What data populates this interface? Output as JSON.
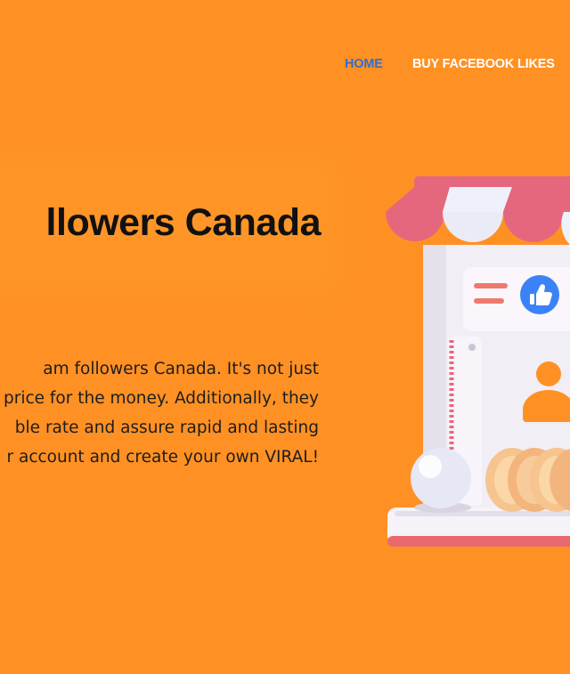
{
  "nav": {
    "home_label": "HOME",
    "buy_facebook_likes_label": "BUY FACEBOOK LIKES"
  },
  "hero": {
    "title": "llowers Canada",
    "paragraph_lines": [
      "am followers Canada. It's not just",
      "price for the money. Additionally, they",
      "ble rate and assure rapid and lasting",
      "r account and create your own VIRAL!"
    ]
  },
  "illustration": {
    "icons": [
      "shop-awning-icon",
      "thumbs-up-icon",
      "user-icon",
      "coins-icon"
    ]
  },
  "colors": {
    "background": "#FF9124",
    "nav_active": "#2F6FD2",
    "nav_default": "#FFFFFF",
    "awning_red": "#E5677D",
    "awning_white": "#EEF1FA",
    "like_blue": "#3B82F6"
  }
}
